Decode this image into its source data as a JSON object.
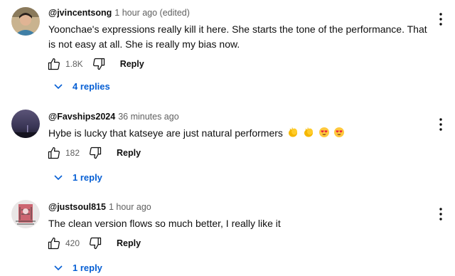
{
  "comments": [
    {
      "author": "@jvincentsong",
      "time": "1 hour ago (edited)",
      "text": "Yoonchae's expressions really kill it here. She starts the tone of the performance. That is not easy at all. She is really my bias now.",
      "likes": "1.8K",
      "reply_label": "Reply",
      "replies_label": "4 replies",
      "avatar_icon": "profile-photo-person"
    },
    {
      "author": "@Favships2024",
      "time": "36 minutes ago",
      "text": "Hybe is lucky that katseye are just natural performers",
      "emojis": [
        "clapping-hands-emoji",
        "clapping-hands-emoji",
        "heart-eyes-emoji",
        "heart-eyes-emoji"
      ],
      "likes": "182",
      "reply_label": "Reply",
      "replies_label": "1 reply",
      "avatar_icon": "profile-photo-night-sky"
    },
    {
      "author": "@justsoul815",
      "time": "1 hour ago",
      "text": "The clean version flows so much better, I really like it",
      "likes": "420",
      "reply_label": "Reply",
      "replies_label": "1 reply",
      "avatar_icon": "profile-photo-sketch"
    }
  ],
  "colors": {
    "link": "#065fd4",
    "secondary_text": "#606060",
    "primary_text": "#0f0f0f"
  }
}
